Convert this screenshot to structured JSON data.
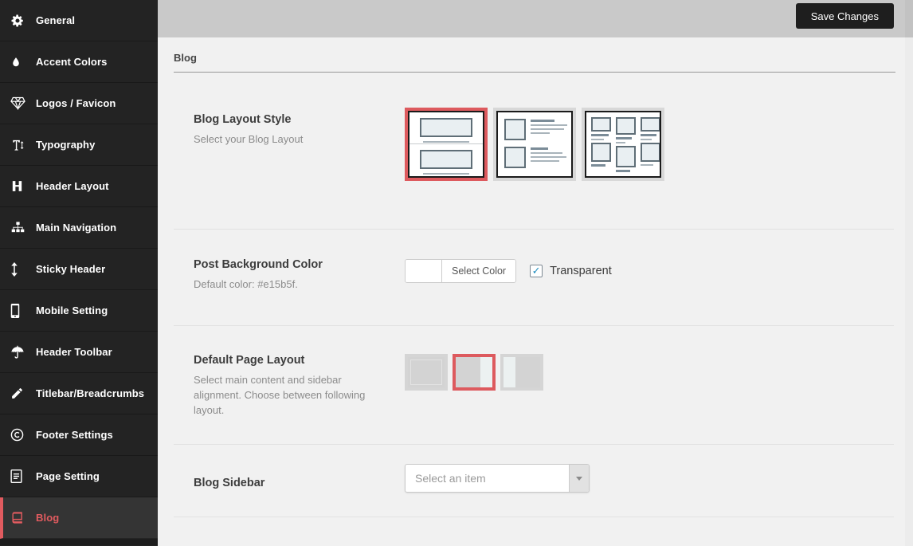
{
  "accent_color": "#e15b5f",
  "topbar": {
    "save_label": "Save Changes"
  },
  "sidebar": {
    "items": [
      {
        "label": "General",
        "icon": "gear-icon",
        "active": false
      },
      {
        "label": "Accent Colors",
        "icon": "droplet-icon",
        "active": false
      },
      {
        "label": "Logos / Favicon",
        "icon": "gem-icon",
        "active": false
      },
      {
        "label": "Typography",
        "icon": "text-height-icon",
        "active": false
      },
      {
        "label": "Header Layout",
        "icon": "header-h-icon",
        "active": false
      },
      {
        "label": "Main Navigation",
        "icon": "sitemap-icon",
        "active": false
      },
      {
        "label": "Sticky Header",
        "icon": "arrows-vertical-icon",
        "active": false
      },
      {
        "label": "Mobile Setting",
        "icon": "mobile-icon",
        "active": false
      },
      {
        "label": "Header Toolbar",
        "icon": "umbrella-icon",
        "active": false
      },
      {
        "label": "Titlebar/Breadcrumbs",
        "icon": "pencil-icon",
        "active": false
      },
      {
        "label": "Footer Settings",
        "icon": "copyright-icon",
        "active": false
      },
      {
        "label": "Page Setting",
        "icon": "page-icon",
        "active": false
      },
      {
        "label": "Blog",
        "icon": "book-icon",
        "active": true
      }
    ]
  },
  "page": {
    "title": "Blog"
  },
  "sections": {
    "blog_layout": {
      "label": "Blog Layout Style",
      "description": "Select your Blog Layout",
      "options": [
        "large-image-list",
        "medium-image-list",
        "masonry-grid"
      ],
      "selected_index": 0
    },
    "post_bg": {
      "label": "Post Background Color",
      "description": "Default color: #e15b5f.",
      "button_label": "Select Color",
      "checkbox_label": "Transparent",
      "checkbox_checked": true
    },
    "page_layout": {
      "label": "Default Page Layout",
      "description": "Select main content and sidebar alignment. Choose between following layout.",
      "options": [
        "full-width",
        "sidebar-right",
        "sidebar-left"
      ],
      "selected_index": 1
    },
    "blog_sidebar": {
      "label": "Blog Sidebar",
      "placeholder": "Select an item"
    }
  },
  "glyphs": {
    "check": "✓"
  }
}
